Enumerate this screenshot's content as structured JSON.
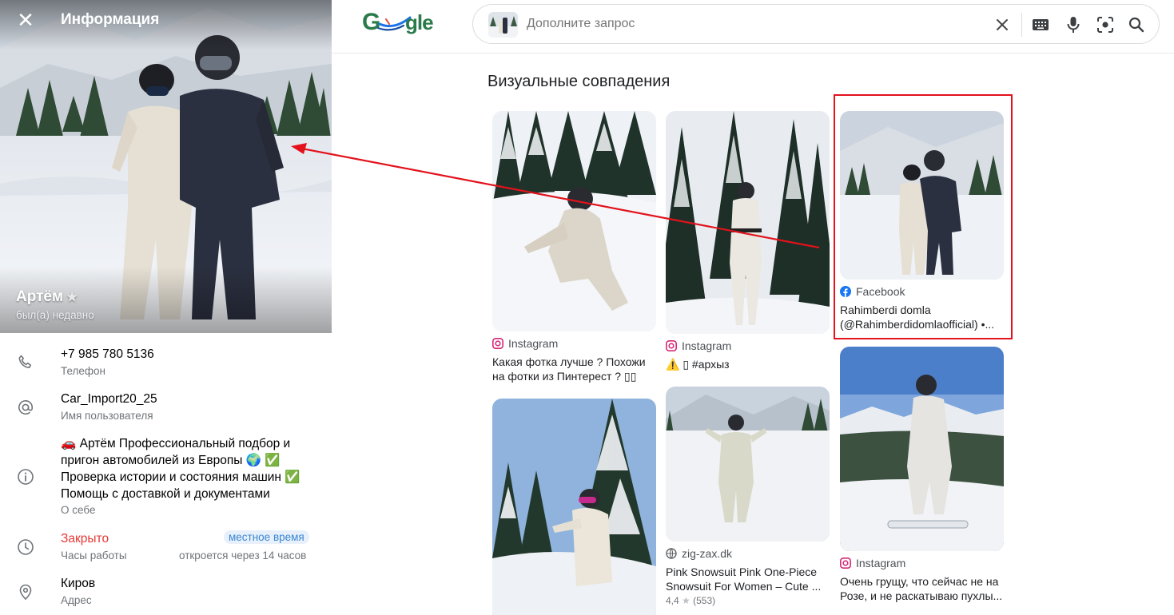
{
  "profile": {
    "header_title": "Информация",
    "close_icon": "close-icon",
    "name": "Артём",
    "status": "был(а) недавно",
    "phone": {
      "value": "+7 985 780 5136",
      "label": "Телефон"
    },
    "username": {
      "value": "Car_Import20_25",
      "label": "Имя пользователя"
    },
    "about": {
      "lines": [
        "🚗 Артём Профессиональный подбор и",
        "пригон автомобилей из Европы 🌍 ✅",
        "Проверка истории и состояния машин ✅",
        "Помощь с доставкой и документами"
      ],
      "label": "О себе"
    },
    "hours": {
      "value": "Закрыто",
      "label": "Часы работы",
      "badge": "местное время",
      "opens": "откроется через 14 часов"
    },
    "address": {
      "value": "Киров",
      "label": "Адрес"
    }
  },
  "google": {
    "logo_text": "Google",
    "search": {
      "placeholder": "Дополните запрос"
    },
    "section_title": "Визуальные совпадения",
    "results": [
      {
        "source": "Instagram",
        "title": "Какая фотка лучше ? Похожи на фотки из Пинтерест ? ▯▯"
      },
      {
        "source": "Instagram",
        "title": "⚠️ ▯ #архыз"
      },
      {
        "source": "Facebook",
        "title": "Rahimberdi domla (@Rahimberdidomlaofficial) •..."
      },
      {
        "source": "",
        "title": ""
      },
      {
        "source": "zig-zax.dk",
        "title": "Pink Snowsuit Pink One-Piece Snowsuit For Women – Cute ...",
        "rating": "4,4",
        "reviews": "(553)"
      },
      {
        "source": "Instagram",
        "title": "Очень грущу, что сейчас не на Розе, и не раскатываю пухлы..."
      }
    ]
  },
  "colors": {
    "accent_red": "#e3121c",
    "closed_red": "#e53935",
    "badge_blue": "#3a86d1"
  }
}
